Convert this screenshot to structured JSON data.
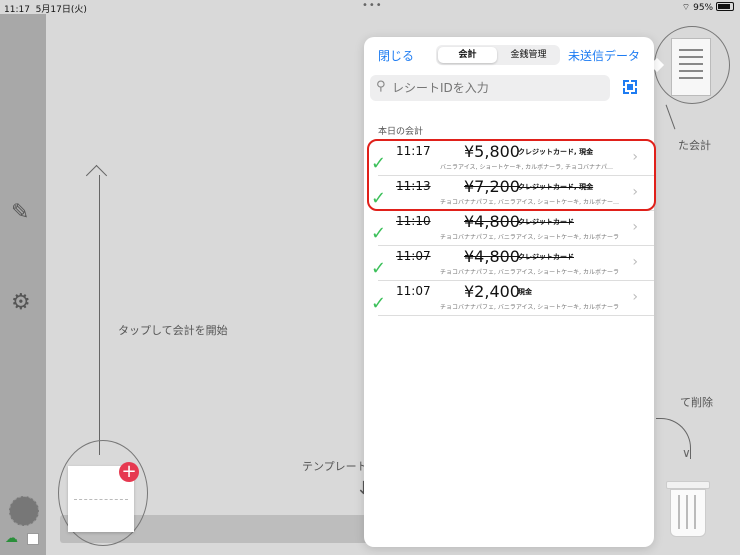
{
  "status_bar": {
    "time": "11:17",
    "date": "5月17日(火)",
    "battery": "95%"
  },
  "left_bar": {
    "edit_icon": "edit-icon",
    "settings_icon": "gear-icon"
  },
  "main_hints": {
    "start_hint": "タップして会計を開始",
    "template_hint": "テンプレート",
    "receipt_hint": "た会計",
    "delete_hint": "て削除"
  },
  "panel": {
    "close": "閉じる",
    "segments": [
      "会計",
      "金銭管理"
    ],
    "unsent": "未送信データ",
    "search_placeholder": "レシートIDを入力",
    "section_title": "本日の会計",
    "rows": [
      {
        "time": "11:17",
        "amount": "¥5,800",
        "payment": "クレジットカード, 現金",
        "items": "バニラアイス, ショートケーキ, カルボナーラ, チョコバナナパ…",
        "cancelled": false
      },
      {
        "time": "11:13",
        "amount": "¥7,200",
        "payment": "クレジットカード, 現金",
        "items": "チョコバナナパフェ, バニラアイス, ショートケーキ, カルボナー…",
        "cancelled": true
      },
      {
        "time": "11:10",
        "amount": "¥4,800",
        "payment": "クレジットカード",
        "items": "チョコバナナパフェ, バニラアイス, ショートケーキ, カルボナーラ",
        "cancelled": true
      },
      {
        "time": "11:07",
        "amount": "¥4,800",
        "payment": "クレジットカード",
        "items": "チョコバナナパフェ, バニラアイス, ショートケーキ, カルボナーラ",
        "cancelled": true
      },
      {
        "time": "11:07",
        "amount": "¥2,400",
        "payment": "現金",
        "items": "チョコバナナパフェ, バニラアイス, ショートケーキ, カルボナーラ",
        "cancelled": false
      }
    ]
  },
  "colors": {
    "accent": "#1e7cf2",
    "check": "#3cc05a",
    "highlight": "#e0201a",
    "add": "#e63950"
  }
}
